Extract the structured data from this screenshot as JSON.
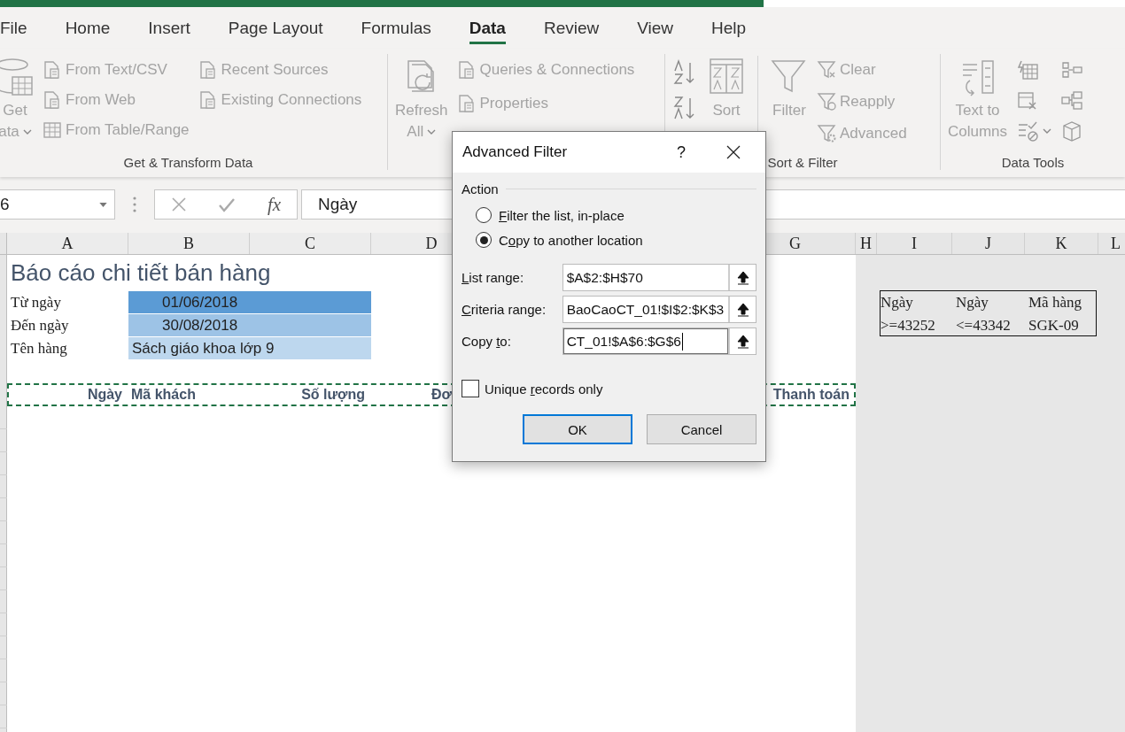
{
  "tabs": [
    {
      "label": "File",
      "selected": false
    },
    {
      "label": "Home",
      "selected": false
    },
    {
      "label": "Insert",
      "selected": false
    },
    {
      "label": "Page Layout",
      "selected": false
    },
    {
      "label": "Formulas",
      "selected": false
    },
    {
      "label": "Data",
      "selected": true
    },
    {
      "label": "Review",
      "selected": false
    },
    {
      "label": "View",
      "selected": false
    },
    {
      "label": "Help",
      "selected": false
    }
  ],
  "ribbon": [
    {
      "label": "Get & Transform Data",
      "items": [
        {
          "kind": "large",
          "lines": [
            "Get",
            "ata"
          ],
          "caret": true
        },
        {
          "kind": "column",
          "buttons": [
            {
              "label": "From Text/CSV"
            },
            {
              "label": "From Web"
            },
            {
              "label": "From Table/Range"
            }
          ]
        },
        {
          "kind": "column",
          "buttons": [
            {
              "label": "Recent Sources"
            },
            {
              "label": "Existing Connections"
            }
          ]
        }
      ]
    },
    {
      "items": [
        {
          "kind": "large",
          "lines": [
            "Refresh",
            "All"
          ],
          "caret": true
        },
        {
          "kind": "column",
          "buttons": [
            {
              "label": "Queries & Connections"
            },
            {
              "label": "Properties"
            }
          ]
        }
      ]
    },
    {
      "label": "Sort & Filter",
      "items": [
        {
          "kind": "icon-column"
        },
        {
          "kind": "large",
          "lines": [
            "Sort"
          ],
          "caret": false
        },
        {
          "kind": "divider"
        },
        {
          "kind": "large",
          "lines": [
            "Filter"
          ],
          "caret": false
        },
        {
          "kind": "column",
          "buttons": [
            {
              "label": "Clear"
            },
            {
              "label": "Reapply"
            },
            {
              "label": "Advanced"
            }
          ]
        }
      ]
    },
    {
      "label": "Data Tools",
      "items": [
        {
          "kind": "large",
          "lines": [
            "Text to",
            "Columns"
          ],
          "caret": false
        },
        {
          "kind": "icon-column"
        },
        {
          "kind": "icon-column"
        }
      ]
    }
  ],
  "formula_bar": {
    "name_box": "6",
    "function_label": "fx",
    "value": "Ngày"
  },
  "sheet": {
    "columns": [
      "A",
      "B",
      "C",
      "D",
      "G",
      "H",
      "I",
      "J",
      "K",
      "L"
    ],
    "rows": [
      {
        "cells": [
          {
            "kind": "title",
            "text": "Báo cáo chi tiết bán hàng"
          }
        ]
      },
      {
        "cells": [
          {
            "kind": "label",
            "text": "Từ ngày"
          },
          {
            "kind": "date",
            "text": "01/06/2018",
            "color": "#5b9bd5"
          },
          "",
          "",
          "",
          "",
          {
            "kind": "criteria",
            "text": "Ngày"
          },
          {
            "kind": "criteria",
            "text": "Ngày"
          },
          {
            "kind": "criteria",
            "text": "Mã hàng"
          }
        ]
      },
      {
        "cells": [
          {
            "kind": "label",
            "text": "Đến ngày"
          },
          {
            "kind": "date",
            "text": "30/08/2018",
            "color": "#9dc3e6"
          },
          "",
          "",
          "",
          "",
          {
            "kind": "criteria",
            "text": ">=43252"
          },
          {
            "kind": "criteria",
            "text": "<=43342"
          },
          {
            "kind": "criteria",
            "text": "SGK-09"
          }
        ]
      },
      {
        "cells": [
          {
            "kind": "label",
            "text": "Tên hàng"
          },
          {
            "kind": "text",
            "text": "Sách giáo khoa lớp 9",
            "color": "#bdd7ee"
          }
        ]
      },
      {
        "cells": []
      },
      {
        "marquee": true,
        "cells": [
          {
            "kind": "header-right",
            "text": "Ngày"
          },
          {
            "kind": "header-left",
            "text": "Mã khách"
          },
          {
            "kind": "header-right",
            "text": "Số lượng"
          },
          {
            "kind": "header-cut",
            "text": "Đơ"
          },
          {
            "kind": "header-right",
            "text": "Thanh toán"
          }
        ]
      }
    ]
  },
  "dialog": {
    "title": "Advanced Filter",
    "help": "?",
    "section": "Action",
    "radios": [
      {
        "key": "F",
        "after": "ilter the list, in-place",
        "selected": false
      },
      {
        "before": "C",
        "key": "o",
        "after": "py to another location",
        "selected": true
      }
    ],
    "fields": [
      {
        "key": "L",
        "after": "ist range:",
        "value": "$A$2:$H$70",
        "focused": false
      },
      {
        "key": "C",
        "after": "riteria range:",
        "value": "BaoCaoCT_01!$I$2:$K$3",
        "focused": false
      },
      {
        "before": "Copy ",
        "key": "t",
        "after": "o:",
        "value": "CT_01!$A$6:$G$6",
        "focused": true
      }
    ],
    "checkbox": {
      "before": "Unique ",
      "key": "r",
      "after": "ecords only",
      "checked": false
    },
    "buttons": [
      {
        "label": "OK",
        "default": true
      },
      {
        "label": "Cancel",
        "default": false
      }
    ]
  }
}
